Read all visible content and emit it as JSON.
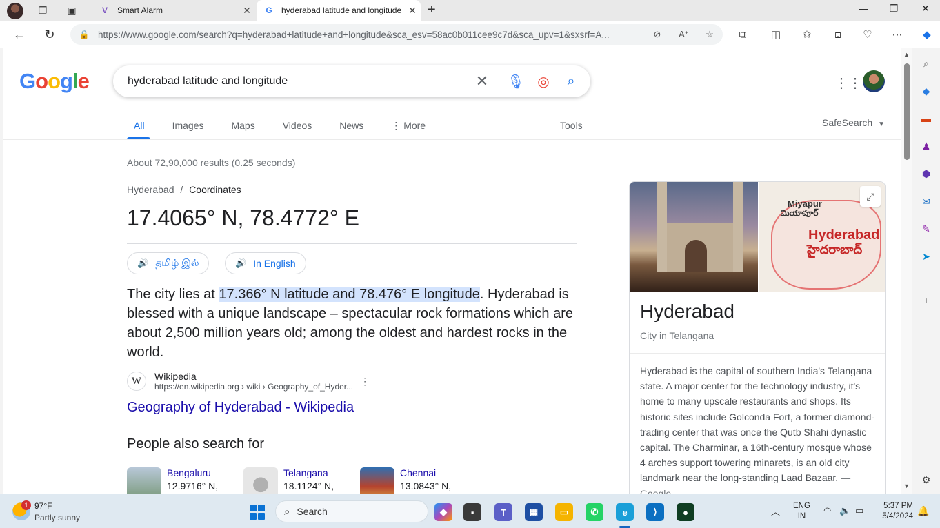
{
  "browser": {
    "tabs": [
      {
        "title": "Smart Alarm",
        "active": false
      },
      {
        "title": "hyderabad latitude and longitude",
        "active": true
      }
    ],
    "url": "https://www.google.com/search?q=hyderabad+latitude+and+longitude&sca_esv=58ac0b011cee9c7d&sca_upv=1&sxsrf=A..."
  },
  "search": {
    "logo": [
      "G",
      "o",
      "o",
      "g",
      "l",
      "e"
    ],
    "query": "hyderabad latitude and longitude",
    "tabs": [
      "All",
      "Images",
      "Maps",
      "Videos",
      "News",
      "More"
    ],
    "active_tab": "All",
    "tools": "Tools",
    "safesearch": "SafeSearch"
  },
  "answer": {
    "stats": "About 72,90,000 results (0.25 seconds)",
    "breadcrumb_parent": "Hyderabad",
    "breadcrumb_sep": "/",
    "breadcrumb_current": "Coordinates",
    "coordinates": "17.4065° N, 78.4772° E",
    "audio_buttons": [
      "தமிழ் இல்",
      "In English"
    ],
    "snippet_pre": "The city lies at ",
    "snippet_highlight": "17.366° N latitude and 78.476° E longitude",
    "snippet_post": ". Hyderabad is blessed with a unique landscape – spectacular rock formations which are about 2,500 million years old; among the oldest and hardest rocks in the world.",
    "source_name": "Wikipedia",
    "source_url": "https://en.wikipedia.org › wiki › Geography_of_Hyder...",
    "link_title": "Geography of Hyderabad - Wikipedia"
  },
  "people_also_search": {
    "title": "People also search for",
    "items": [
      {
        "name": "Bengaluru",
        "value": "12.9716° N,",
        "color": "#7a9a7a"
      },
      {
        "name": "Telangana",
        "value": "18.1124° N,",
        "color": "#cfcfcf"
      },
      {
        "name": "Chennai",
        "value": "13.0843° N,",
        "color": "#2f6fb2"
      }
    ]
  },
  "knowledge_panel": {
    "title": "Hyderabad",
    "subtitle": "City in Telangana",
    "map_label_1": "Miyapur",
    "map_label_1_te": "మియాపూర్",
    "map_label_2": "Hyderabad",
    "map_label_2_te": "హైదరాబాద్",
    "description": "Hyderabad is the capital of southern India's Telangana state. A major center for the technology industry, it's home to many upscale restaurants and shops. Its historic sites include Golconda Fort, a former diamond-trading center that was once the Qutb Shahi dynastic capital. The Charminar, a 16th-century mosque whose 4 arches support towering minarets, is an old city landmark near the long-standing Laad Bazaar.",
    "desc_source": "— Google"
  },
  "taskbar": {
    "weather_temp": "97°F",
    "weather_desc": "Partly sunny",
    "weather_badge": "1",
    "search_label": "Search",
    "lang_line1": "ENG",
    "lang_line2": "IN",
    "time": "5:37 PM",
    "date": "5/4/2024"
  },
  "colors": {
    "accent": "#1a73e8",
    "link": "#1a0dab",
    "highlight": "#d3e3fd"
  }
}
